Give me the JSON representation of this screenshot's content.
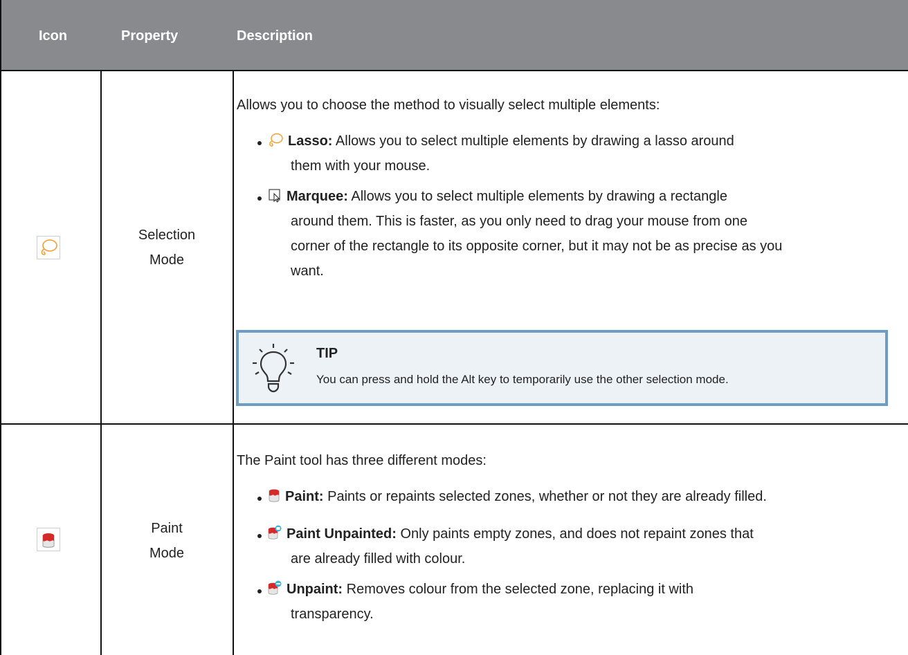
{
  "table": {
    "headers": {
      "icon": "Icon",
      "property": "Property",
      "description": "Description"
    },
    "rows": [
      {
        "icon": "lasso-icon",
        "property_line1": "Selection",
        "property_line2": "Mode",
        "intro": "Allows you to choose the method to visually select multiple elements:",
        "items": [
          {
            "icon": "lasso-icon",
            "label": "Lasso:",
            "line1": " Allows you to select multiple elements by drawing a lasso around",
            "line2": "them with your mouse."
          },
          {
            "icon": "marquee-icon",
            "label": "Marquee:",
            "line1": " Allows you to select multiple elements by drawing a rectangle",
            "line2": "around them. This is faster, as you only need to drag your mouse from one",
            "line3": "corner of the rectangle to its opposite corner, but it may not be as precise as you",
            "line4": "want."
          }
        ],
        "tip": {
          "title": "TIP",
          "text": "You can press and hold the Alt key to temporarily use the other selection mode."
        }
      },
      {
        "icon": "paint-bucket-icon",
        "property_line1": "Paint",
        "property_line2": "Mode",
        "intro": "The Paint tool has three different modes:",
        "items": [
          {
            "icon": "paint-icon",
            "label": "Paint:",
            "line1": " Paints or repaints selected zones, whether or not they are already filled."
          },
          {
            "icon": "paint-unpainted-icon",
            "label": "Paint Unpainted:",
            "line1": "  Only paints empty zones, and does not repaint zones that",
            "line2": "are already filled with colour."
          },
          {
            "icon": "unpaint-icon",
            "label": "Unpaint:",
            "line1": " Removes colour from the selected zone, replacing it with",
            "line2": "transparency."
          }
        ]
      }
    ]
  },
  "colors": {
    "header_bg": "#898a8e",
    "tip_border": "#6d9dc5",
    "tip_bg": "#edf2f7",
    "lasso": "#f0a030",
    "paint_red": "#d42a2a"
  }
}
